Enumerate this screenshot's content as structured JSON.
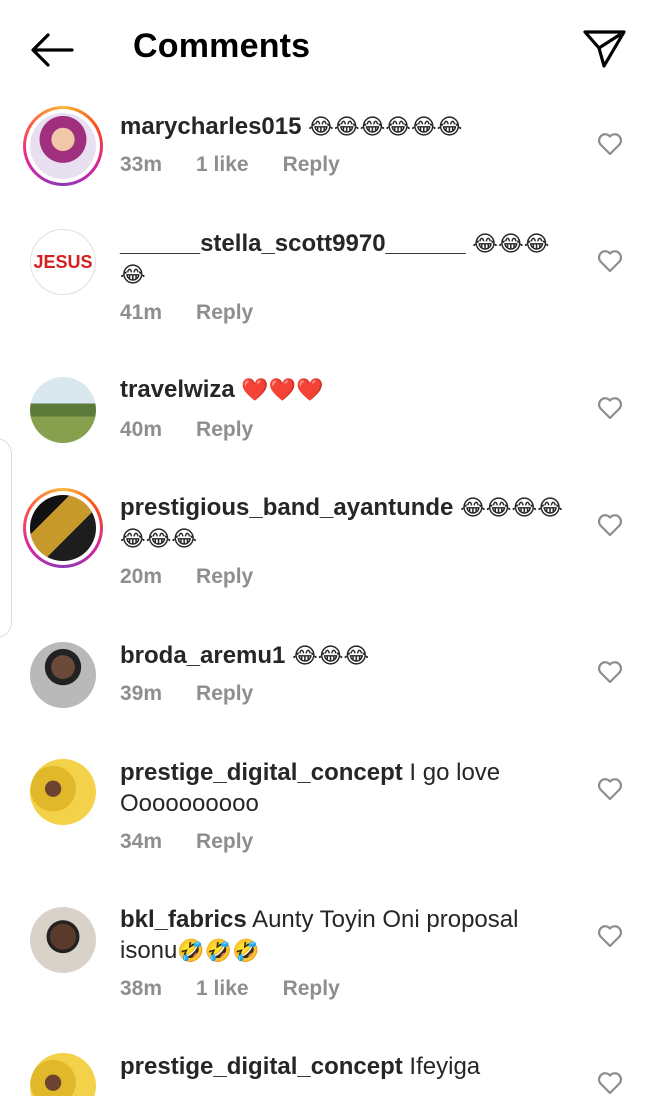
{
  "header": {
    "title": "Comments",
    "back_icon": "arrow-left-icon",
    "send_icon": "paper-plane-icon"
  },
  "comments": [
    {
      "user": "marycharles015",
      "text": "",
      "emoji": "😂😂😂😂😂😂",
      "time": "33m",
      "likes": "1 like",
      "reply": "Reply",
      "story_ring": true,
      "avatar": "avatar-woman-purple"
    },
    {
      "user": "______stella_scott9970______",
      "text": "",
      "emoji": "😂😂😂😂",
      "time": "41m",
      "likes": "",
      "reply": "Reply",
      "story_ring": false,
      "avatar": "avatar-jesus-text",
      "avatar_text": "JESUS"
    },
    {
      "user": "travelwiza",
      "text": "",
      "emoji": "❤️❤️❤️",
      "time": "40m",
      "likes": "",
      "reply": "Reply",
      "story_ring": false,
      "avatar": "avatar-landscape"
    },
    {
      "user": "prestigious_band_ayantunde",
      "text": "",
      "emoji": "😂😂😂😂😂😂😂",
      "time": "20m",
      "likes": "",
      "reply": "Reply",
      "story_ring": true,
      "avatar": "avatar-band-poster"
    },
    {
      "user": "broda_aremu1",
      "text": "",
      "emoji": "😂😂😂",
      "time": "39m",
      "likes": "",
      "reply": "Reply",
      "story_ring": false,
      "avatar": "avatar-man-cap"
    },
    {
      "user": "prestige_digital_concept",
      "text": "I go love Oooooooooo",
      "emoji": "",
      "time": "34m",
      "likes": "",
      "reply": "Reply",
      "story_ring": false,
      "avatar": "avatar-couple-yellow"
    },
    {
      "user": "bkl_fabrics",
      "text": "Aunty Toyin Oni proposal isonu",
      "emoji": "🤣🤣🤣",
      "time": "38m",
      "likes": "1 like",
      "reply": "Reply",
      "story_ring": false,
      "avatar": "avatar-woman-smile"
    },
    {
      "user": "prestige_digital_concept",
      "text": "Ifeyiga",
      "emoji": "",
      "time": "",
      "likes": "",
      "reply": "",
      "story_ring": false,
      "avatar": "avatar-couple-yellow"
    }
  ],
  "colors": {
    "accent_text": "#262626",
    "meta": "#8e8e8e",
    "heart": "#8e8e8e"
  }
}
